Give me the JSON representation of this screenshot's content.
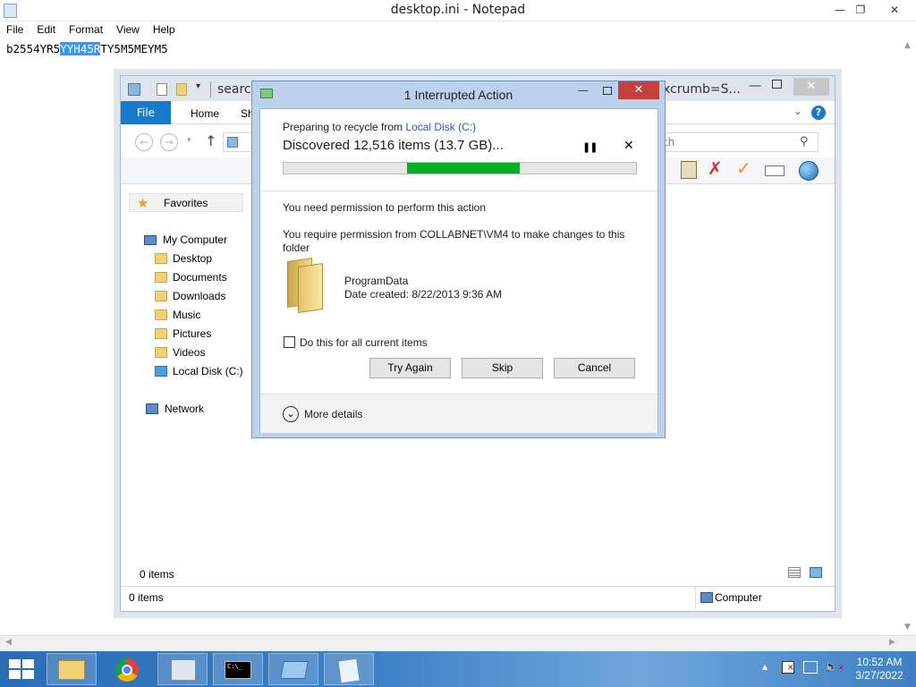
{
  "notepad": {
    "title": "desktop.ini - Notepad",
    "menu": [
      "File",
      "Edit",
      "Format",
      "View",
      "Help"
    ],
    "text_before": "b2554YR5",
    "text_selected": "YYH45R",
    "text_after": "TY5M5MEYM5"
  },
  "explorer": {
    "address_fragment": "search",
    "address_fragment2": "xcrumb=S...",
    "search_fragment": "ch",
    "ribbon_tabs": [
      "File",
      "Home",
      "Sh"
    ],
    "favorites": "Favorites",
    "my_computer": "My Computer",
    "folders": [
      "Desktop",
      "Documents",
      "Downloads",
      "Music",
      "Pictures",
      "Videos",
      "Local Disk (C:)"
    ],
    "network": "Network",
    "items_count": "0 items",
    "status_items": "0 items",
    "status_location": "Computer"
  },
  "dialog": {
    "title": "1 Interrupted Action",
    "preparing_prefix": "Preparing to recycle from ",
    "preparing_link": "Local Disk (C:)",
    "discovered": "Discovered 12,516 items (13.7 GB)...",
    "progress_start": 0.35,
    "progress_end": 0.67,
    "permission_heading": "You need permission to perform this action",
    "permission_detail": "You require permission from COLLABNET\\VM4 to make changes to this folder",
    "folder_name": "ProgramData",
    "folder_date": "Date created: 8/22/2013 9:36 AM",
    "checkbox_label": "Do this for all current items",
    "btn_try_again": "Try Again",
    "btn_skip": "Skip",
    "btn_cancel": "Cancel",
    "more_details": "More details"
  },
  "taskbar": {
    "time": "10:52 AM",
    "date": "3/27/2022"
  },
  "colors": {
    "accent": "#1979ca",
    "progress": "#06b025",
    "close_red": "#c7403a"
  }
}
